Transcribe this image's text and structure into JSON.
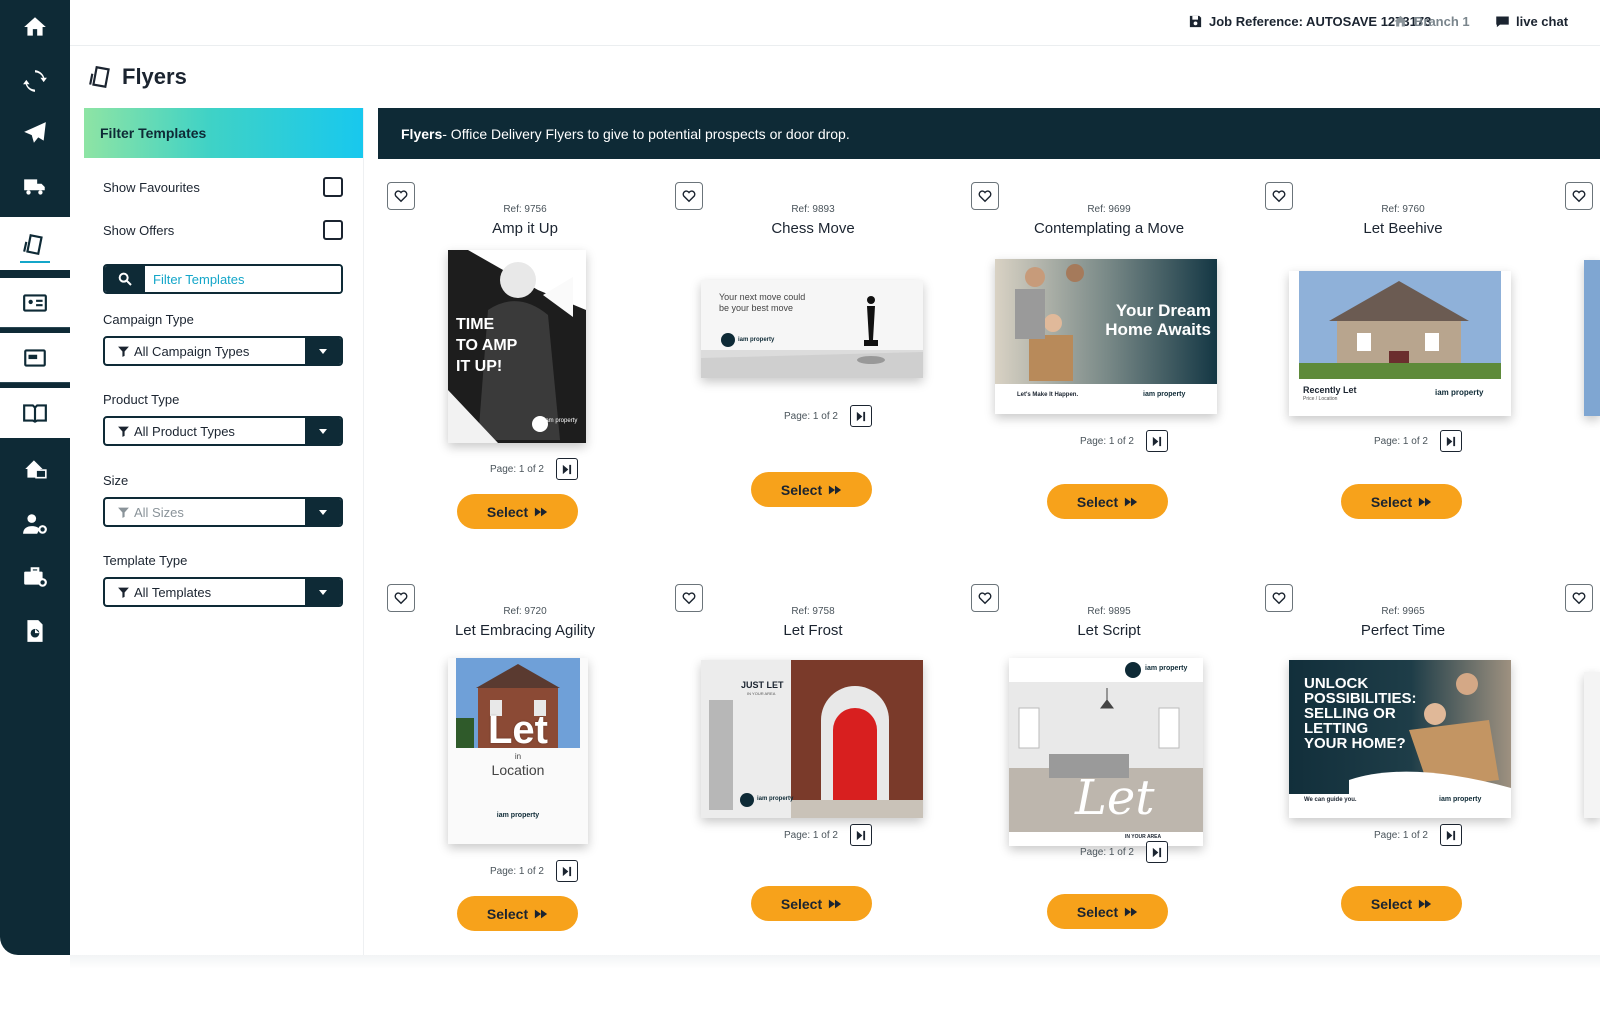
{
  "topbar": {
    "job_reference": "Job Reference: AUTOSAVE 1273173",
    "branch": "Branch 1",
    "live_chat": "live chat"
  },
  "page": {
    "title": "Flyers"
  },
  "filter": {
    "header": "Filter Templates",
    "show_favourites": "Show Favourites",
    "show_offers": "Show Offers",
    "search_placeholder": "Filter Templates",
    "campaign_label": "Campaign Type",
    "campaign_value": "All Campaign Types",
    "product_label": "Product Type",
    "product_value": "All Product Types",
    "size_label": "Size",
    "size_value": "All Sizes",
    "template_label": "Template Type",
    "template_value": "All Templates"
  },
  "banner": {
    "bold": "Flyers",
    "text": " - Office Delivery Flyers to give to potential prospects or door drop."
  },
  "colors": {
    "navy": "#0e2a36",
    "accent_orange": "#f7a21b",
    "accent_teal": "#14a6c9"
  },
  "templates": [
    {
      "ref": "Ref: 9756",
      "name": "Amp it Up",
      "page": "Page: 1 of 2",
      "select": "Select",
      "thumb_lines": [
        "TIME",
        "TO AMP",
        "IT UP!"
      ],
      "brand": "iam property"
    },
    {
      "ref": "Ref: 9893",
      "name": "Chess Move",
      "page": "Page: 1 of 2",
      "select": "Select",
      "thumb_lines": [
        "Your next move could",
        "be your best move"
      ],
      "brand": "iam property"
    },
    {
      "ref": "Ref: 9699",
      "name": "Contemplating a Move",
      "page": "Page: 1 of 2",
      "select": "Select",
      "thumb_lines": [
        "Your Dream",
        "Home Awaits"
      ],
      "tagline": "Let's Make It Happen.",
      "brand": "iam property"
    },
    {
      "ref": "Ref: 9760",
      "name": "Let Beehive",
      "page": "Page: 1 of 2",
      "select": "Select",
      "thumb_lines": [
        "Recently Let"
      ],
      "tagline": "Price / Location",
      "brand": "iam property"
    },
    {
      "ref": "Ref: 9720",
      "name": "Let Embracing Agility",
      "page": "Page: 1 of 2",
      "select": "Select",
      "thumb_lines": [
        "Let",
        "in",
        "Location"
      ],
      "brand": "iam property"
    },
    {
      "ref": "Ref: 9758",
      "name": "Let Frost",
      "page": "Page: 1 of 2",
      "select": "Select",
      "thumb_lines": [
        "JUST LET"
      ],
      "tagline": "IN YOUR AREA",
      "brand": "iam property"
    },
    {
      "ref": "Ref: 9895",
      "name": "Let Script",
      "page": "Page: 1 of 2",
      "select": "Select",
      "thumb_lines": [
        "Let"
      ],
      "tagline": "IN YOUR AREA",
      "brand": "iam property"
    },
    {
      "ref": "Ref: 9965",
      "name": "Perfect Time",
      "page": "Page: 1 of 2",
      "select": "Select",
      "thumb_lines": [
        "UNLOCK",
        "POSSIBILITIES:",
        "SELLING OR",
        "LETTING",
        "YOUR HOME?"
      ],
      "tagline": "We can guide you.",
      "brand": "iam property"
    }
  ]
}
